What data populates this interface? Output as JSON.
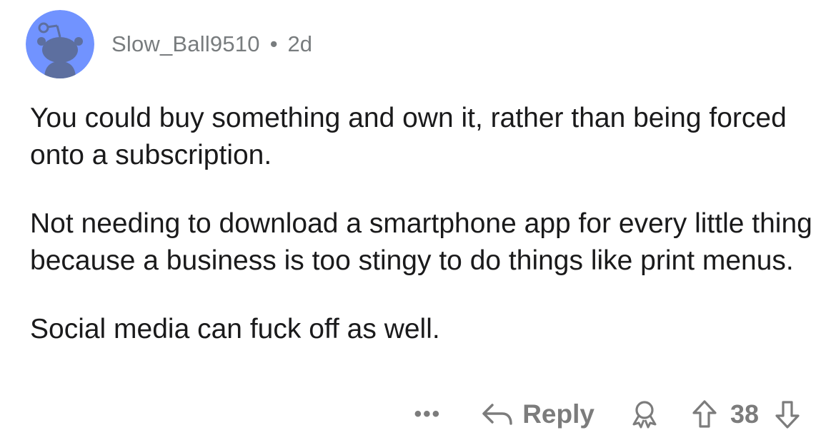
{
  "comment": {
    "username": "Slow_Ball9510",
    "separator": "•",
    "age": "2d",
    "paragraphs": [
      "You could buy something and own it, rather than being forced onto a subscription.",
      "Not needing to download a smartphone app for every little thing because a business is too stingy to do things like print menus.",
      "Social media can fuck off as well."
    ]
  },
  "actions": {
    "more_label": "•••",
    "reply_label": "Reply",
    "vote_count": "38"
  },
  "icons": {
    "avatar": "reddit-snoo-avatar-icon",
    "reply": "reply-arrow-icon",
    "award": "award-icon",
    "upvote": "upvote-arrow-icon",
    "downvote": "downvote-arrow-icon"
  },
  "colors": {
    "avatar_bg": "#7193ff",
    "muted_text": "#787c7e",
    "body_text": "#1a1a1b",
    "action_gray": "#7c7c7c"
  }
}
